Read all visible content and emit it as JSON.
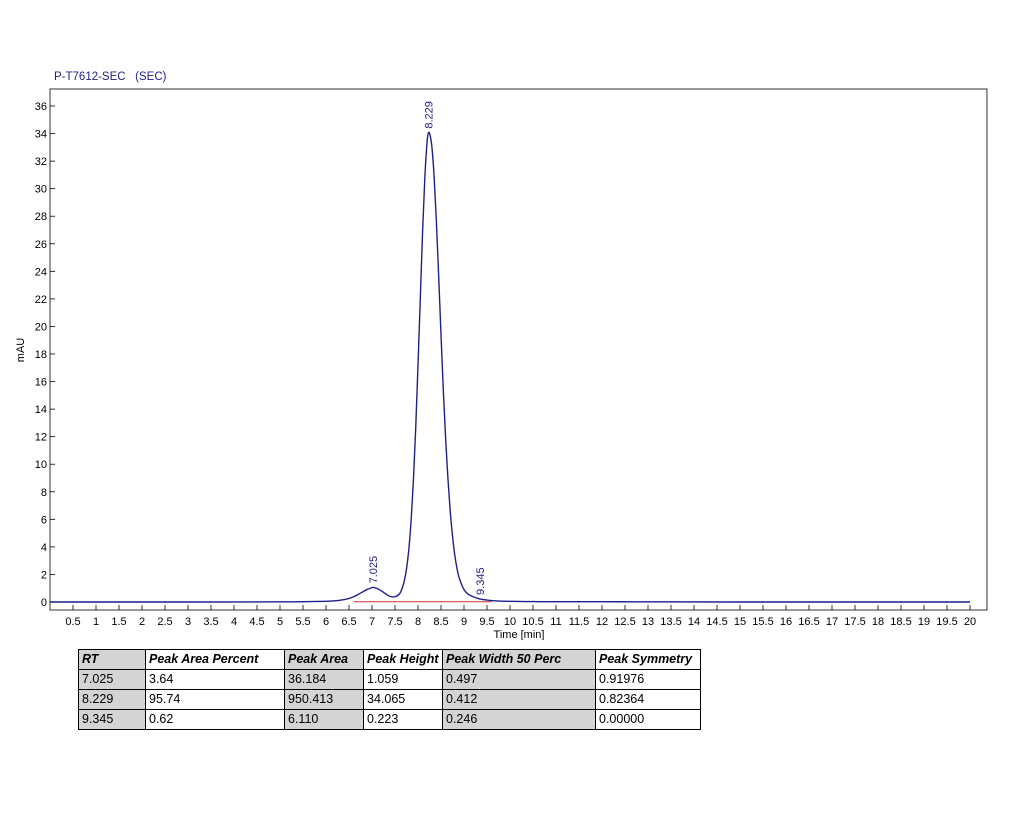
{
  "chart_data": {
    "type": "line",
    "title": "P-T7612-SEC   (SEC)",
    "xlabel": "Time [min]",
    "ylabel": "mAU",
    "xlim": [
      0,
      20.4
    ],
    "ylim": [
      -0.8,
      37.2
    ],
    "x_ticks": [
      "0.5",
      "1",
      "1.5",
      "2",
      "2.5",
      "3",
      "3.5",
      "4",
      "4.5",
      "5",
      "5.5",
      "6",
      "6.5",
      "7",
      "7.5",
      "8",
      "8.5",
      "9",
      "9.5",
      "10",
      "10.5",
      "11",
      "11.5",
      "12",
      "12.5",
      "13",
      "13.5",
      "14",
      "14.5",
      "15",
      "15.5",
      "16",
      "16.5",
      "17",
      "17.5",
      "18",
      "18.5",
      "19",
      "19.5",
      "20"
    ],
    "y_ticks": [
      "0",
      "2",
      "4",
      "6",
      "8",
      "10",
      "12",
      "14",
      "16",
      "18",
      "20",
      "22",
      "24",
      "26",
      "28",
      "30",
      "32",
      "34",
      "36"
    ],
    "series": [
      {
        "color": "#1f1f8c",
        "x": [
          0,
          3,
          5,
          5.5,
          6,
          6.2,
          6.4,
          6.5,
          6.6,
          6.7,
          6.8,
          6.9,
          7.0,
          7.025,
          7.1,
          7.2,
          7.3,
          7.4,
          7.5,
          7.6,
          7.65,
          7.7,
          7.75,
          7.8,
          7.85,
          7.9,
          7.95,
          8.0,
          8.05,
          8.1,
          8.15,
          8.2,
          8.229,
          8.26,
          8.3,
          8.35,
          8.4,
          8.45,
          8.5,
          8.55,
          8.6,
          8.65,
          8.7,
          8.75,
          8.8,
          8.85,
          8.9,
          9.0,
          9.1,
          9.2,
          9.3,
          9.345,
          9.4,
          9.5,
          9.7,
          10.0,
          10.5,
          11,
          12,
          13,
          15,
          18,
          20
        ],
        "y": [
          0,
          0,
          0.01,
          0.02,
          0.05,
          0.09,
          0.18,
          0.26,
          0.38,
          0.55,
          0.74,
          0.92,
          1.04,
          1.059,
          1.0,
          0.82,
          0.58,
          0.4,
          0.38,
          0.6,
          0.95,
          1.5,
          2.4,
          3.8,
          5.9,
          8.8,
          12.6,
          17.2,
          22.0,
          26.9,
          30.9,
          33.5,
          34.065,
          33.9,
          33.1,
          30.9,
          27.6,
          23.6,
          19.4,
          15.4,
          11.9,
          9.0,
          6.6,
          4.8,
          3.4,
          2.4,
          1.7,
          0.9,
          0.55,
          0.38,
          0.26,
          0.223,
          0.19,
          0.14,
          0.08,
          0.05,
          0.03,
          0.02,
          0.02,
          0.01,
          0.0,
          0.0,
          0.0
        ]
      }
    ],
    "baseline": {
      "color": "#cc3333",
      "x": [
        6.6,
        9.6
      ],
      "y": [
        0.02,
        0.02
      ]
    },
    "peak_labels": [
      {
        "rt": 7.025,
        "height": 1.059,
        "text": "7.025"
      },
      {
        "rt": 8.229,
        "height": 34.065,
        "text": "8.229"
      },
      {
        "rt": 9.345,
        "height": 0.223,
        "text": "9.345"
      }
    ],
    "grid": false
  },
  "table": {
    "headers": [
      "RT",
      "Peak Area Percent",
      "Peak Area",
      "Peak Height",
      "Peak Width 50 Perc",
      "Peak Symmetry"
    ],
    "rows": [
      [
        "7.025",
        "3.64",
        "36.184",
        "1.059",
        "0.497",
        "0.91976"
      ],
      [
        "8.229",
        "95.74",
        "950.413",
        "34.065",
        "0.412",
        "0.82364"
      ],
      [
        "9.345",
        "0.62",
        "6.110",
        "0.223",
        "0.246",
        "0.00000"
      ]
    ]
  }
}
